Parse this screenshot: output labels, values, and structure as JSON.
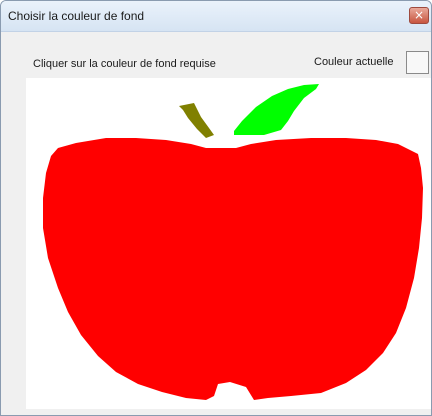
{
  "window": {
    "title": "Choisir la couleur de fond",
    "close_symbol": "×"
  },
  "dialog": {
    "instruction": "Cliquer sur la couleur de fond requise",
    "current_color_label": "Couleur actuelle"
  },
  "picture": {
    "colors": {
      "apple_body": "#ff0000",
      "leaf": "#00ff00",
      "stem": "#808000",
      "background": "#ffffff"
    }
  }
}
